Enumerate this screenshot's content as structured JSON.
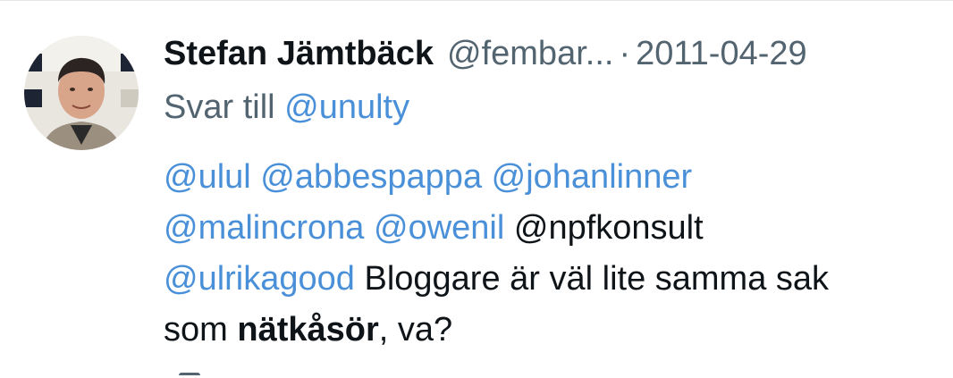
{
  "tweet": {
    "author_name": "Stefan Jämtbäck",
    "author_handle": "@fembar...",
    "separator": "·",
    "date": "2011-04-29",
    "reply_prefix": "Svar till",
    "reply_to": "@unulty",
    "body": {
      "line1": {
        "m1": "@ulul",
        "m2": "@abbespappa",
        "m3": "@johanlinner"
      },
      "line2": {
        "m1": "@malincrona",
        "m2": "@owenil",
        "plain1": "@npfkonsult"
      },
      "line3": {
        "m1": "@ulrikagood",
        "text": "Bloggare är väl lite samma sak"
      },
      "line4": {
        "text_before": "som",
        "bold": "nätkåsör",
        "text_after": ", va?"
      }
    },
    "avatar_icon": "profile-photo",
    "colors": {
      "link": "#4a90d9",
      "text": "#0f1419",
      "muted": "#536471"
    }
  }
}
